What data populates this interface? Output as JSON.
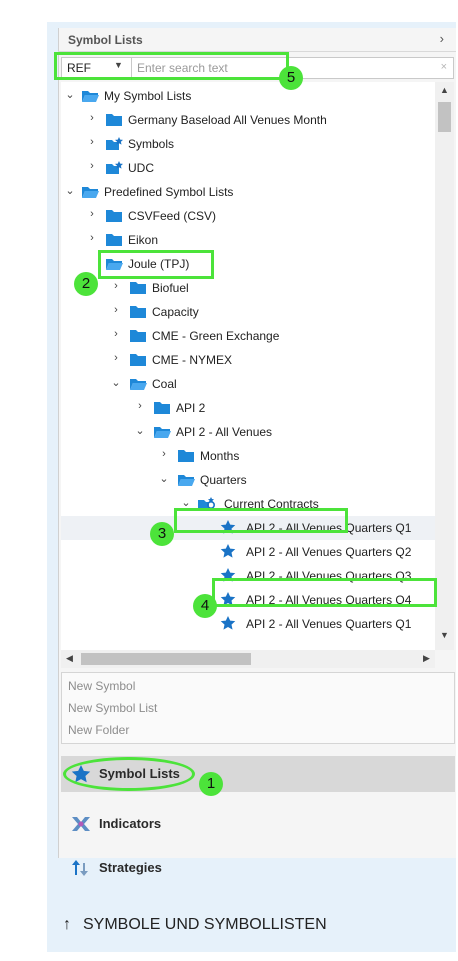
{
  "header": {
    "title": "Symbol Lists",
    "chevron_icon": "chevron-right-icon"
  },
  "search": {
    "type_value": "REF",
    "placeholder": "Enter search text",
    "clear_glyph": "×"
  },
  "tree": [
    {
      "label": "My Symbol Lists",
      "icon": "folder-open-icon",
      "expanded": true
    },
    {
      "label": "Germany Baseload All Venues Month",
      "icon": "folder-icon",
      "expanded": false
    },
    {
      "label": "Symbols",
      "icon": "starred-folder-icon",
      "expanded": false
    },
    {
      "label": "UDC",
      "icon": "starred-folder-icon",
      "expanded": false
    },
    {
      "label": "Predefined Symbol Lists",
      "icon": "folder-open-icon",
      "expanded": true
    },
    {
      "label": "CSVFeed (CSV)",
      "icon": "folder-icon",
      "expanded": false
    },
    {
      "label": "Eikon",
      "icon": "folder-icon",
      "expanded": false
    },
    {
      "label": "Joule (TPJ)",
      "icon": "folder-open-icon",
      "expanded": true
    },
    {
      "label": "Biofuel",
      "icon": "folder-icon",
      "expanded": false
    },
    {
      "label": "Capacity",
      "icon": "folder-icon",
      "expanded": false
    },
    {
      "label": "CME - Green Exchange",
      "icon": "folder-icon",
      "expanded": false
    },
    {
      "label": "CME - NYMEX",
      "icon": "folder-icon",
      "expanded": false
    },
    {
      "label": "Coal",
      "icon": "folder-open-icon",
      "expanded": true
    },
    {
      "label": "API 2",
      "icon": "folder-icon",
      "expanded": false
    },
    {
      "label": "API 2 - All Venues",
      "icon": "folder-open-icon",
      "expanded": true
    },
    {
      "label": "Months",
      "icon": "folder-icon",
      "expanded": false
    },
    {
      "label": "Quarters",
      "icon": "folder-open-icon",
      "expanded": true
    },
    {
      "label": "Current Contracts",
      "icon": "dynamic-list-icon",
      "expanded": true
    },
    {
      "label": "API 2 - All Venues Quarters Q1",
      "icon": "star-icon"
    },
    {
      "label": "API 2 - All Venues Quarters Q2",
      "icon": "star-icon"
    },
    {
      "label": "API 2 - All Venues Quarters Q3",
      "icon": "star-icon"
    },
    {
      "label": "API 2 - All Venues Quarters Q4",
      "icon": "star-icon"
    },
    {
      "label": "API 2 - All Venues Quarters Q1",
      "icon": "star-icon"
    }
  ],
  "actions": {
    "new_symbol": "New Symbol",
    "new_symbol_list": "New Symbol List",
    "new_folder": "New Folder"
  },
  "nav": {
    "symbol_lists": "Symbol Lists",
    "indicators": "Indicators",
    "strategies": "Strategies",
    "selected": "Symbol Lists"
  },
  "badges": {
    "b1": "1",
    "b2": "2",
    "b3": "3",
    "b4": "4",
    "b5": "5"
  },
  "footer": {
    "arrow": "↑",
    "text": "SYMBOLE UND SYMBOLLISTEN"
  },
  "colors": {
    "folder": "#1e88d8",
    "star": "#1a73c6",
    "highlight": "#4ce33a",
    "nav_selected": "#d8d8d8",
    "frame": "#e6f1fa"
  }
}
